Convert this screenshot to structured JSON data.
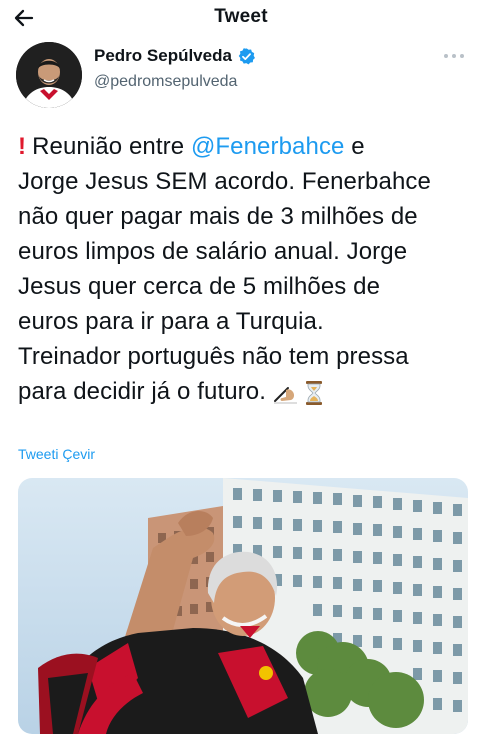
{
  "header": {
    "title": "Tweet",
    "back_icon": "arrow-left-icon"
  },
  "author": {
    "name": "Pedro Sepúlveda",
    "handle": "@pedromsepulveda",
    "verified": true,
    "verified_color": "#1d9bf0"
  },
  "tweet": {
    "lines": [
      {
        "prefix_icon": "exclamation-icon",
        "text_before": "Reunião entre ",
        "mention": "@Fenerbahce",
        "text_after": " e"
      },
      "Jorge Jesus SEM acordo. Fenerbahce",
      "não quer pagar mais de 3 milhões de",
      "euros limpos de salário anual. Jorge",
      "Jesus quer cerca de 5 milhões de",
      "euros para ir para a Turquia.",
      "Treinador português não tem pressa",
      "para decidir já o futuro."
    ],
    "trailing_icons": [
      "writing-hand-icon",
      "hourglass-icon"
    ],
    "mention_color": "#1d9bf0",
    "exclamation_color": "#e0192d"
  },
  "translate_label": "Tweeti Çevir"
}
